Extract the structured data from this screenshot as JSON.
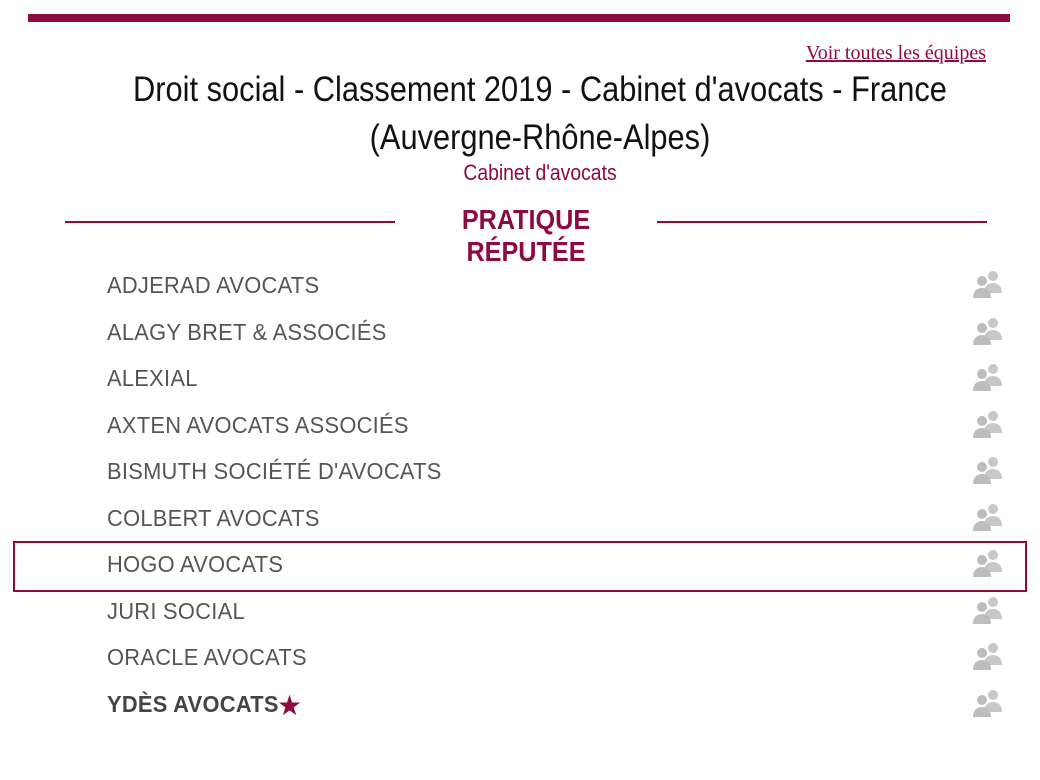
{
  "header": {
    "see_all_link": "Voir toutes les équipes",
    "title": "Droit social - Classement 2019 - Cabinet d'avocats - France (Auvergne-Rhône-Alpes)",
    "subtitle": "Cabinet d'avocats",
    "tier_label": "PRATIQUE RÉPUTÉE"
  },
  "colors": {
    "accent": "#8f0a3f",
    "text": "#555555",
    "icon": "#c8c8c8"
  },
  "firms": [
    {
      "name": "ADJERAD AVOCATS",
      "icon": "team-icon"
    },
    {
      "name": "ALAGY BRET & ASSOCIÉS",
      "icon": "team-icon"
    },
    {
      "name": "ALEXIAL",
      "icon": "team-icon"
    },
    {
      "name": "AXTEN AVOCATS ASSOCIÉS",
      "icon": "team-icon"
    },
    {
      "name": "BISMUTH SOCIÉTÉ D'AVOCATS",
      "icon": "team-icon"
    },
    {
      "name": "COLBERT AVOCATS",
      "icon": "team-icon"
    },
    {
      "name": "HOGO AVOCATS",
      "icon": "team-icon",
      "highlighted": true
    },
    {
      "name": "JURI SOCIAL",
      "icon": "team-icon"
    },
    {
      "name": "ORACLE AVOCATS",
      "icon": "team-icon"
    },
    {
      "name": "YDÈS AVOCATS",
      "icon": "team-icon",
      "bold": true,
      "star": "★"
    }
  ]
}
